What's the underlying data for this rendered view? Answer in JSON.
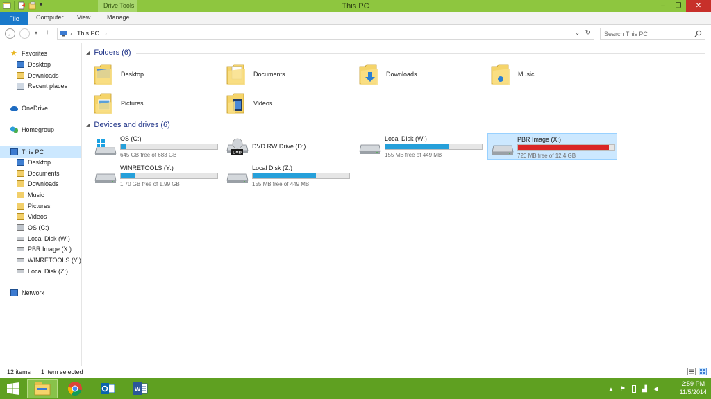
{
  "window": {
    "title": "This PC",
    "context_tab_group": "Drive Tools",
    "controls": {
      "minimize": "–",
      "maximize": "❐",
      "close": "✕"
    }
  },
  "ribbon": {
    "tabs": [
      {
        "label": "File"
      },
      {
        "label": "Computer"
      },
      {
        "label": "View"
      },
      {
        "label": "Manage"
      }
    ]
  },
  "address_bar": {
    "path": "This PC",
    "search_placeholder": "Search This PC",
    "icons": [
      "back-icon",
      "forward-icon",
      "recent-dropdown-icon",
      "up-icon",
      "computer-icon",
      "refresh-icon",
      "search-icon"
    ]
  },
  "nav_pane": {
    "favorites": {
      "label": "Favorites",
      "items": [
        "Desktop",
        "Downloads",
        "Recent places"
      ]
    },
    "onedrive": {
      "label": "OneDrive"
    },
    "homegroup": {
      "label": "Homegroup"
    },
    "this_pc": {
      "label": "This PC",
      "items": [
        "Desktop",
        "Documents",
        "Downloads",
        "Music",
        "Pictures",
        "Videos",
        "OS (C:)",
        "Local Disk (W:)",
        "PBR Image (X:)",
        "WINRETOOLS (Y:)",
        "Local Disk (Z:)"
      ]
    },
    "network": {
      "label": "Network"
    }
  },
  "folders": {
    "header": "Folders (6)",
    "items": [
      "Desktop",
      "Documents",
      "Downloads",
      "Music",
      "Pictures",
      "Videos"
    ]
  },
  "drives": {
    "header": "Devices and drives (6)",
    "items": [
      {
        "name": "OS (C:)",
        "free": "645 GB free of 683 GB",
        "used_fraction": 0.056,
        "icon": "windows-drive-icon"
      },
      {
        "name": "DVD RW Drive (D:)",
        "free": "",
        "used_fraction": null,
        "icon": "dvd-drive-icon"
      },
      {
        "name": "Local Disk (W:)",
        "free": "155 MB free of 449 MB",
        "used_fraction": 0.655,
        "icon": "hard-drive-icon"
      },
      {
        "name": "PBR Image (X:)",
        "free": "720 MB free of 12.4 GB",
        "used_fraction": 0.943,
        "icon": "hard-drive-icon",
        "selected": true
      },
      {
        "name": "WINRETOOLS (Y:)",
        "free": "1.70 GB free of 1.99 GB",
        "used_fraction": 0.146,
        "icon": "hard-drive-icon"
      },
      {
        "name": "Local Disk (Z:)",
        "free": "155 MB free of 449 MB",
        "used_fraction": 0.655,
        "icon": "hard-drive-icon"
      }
    ]
  },
  "status": {
    "items_count": "12 items",
    "selected_count": "1 item selected"
  },
  "taskbar": {
    "apps": [
      "file-explorer-icon",
      "chrome-icon",
      "outlook-icon",
      "word-icon"
    ],
    "clock_time": "2:59 PM",
    "clock_date": "11/5/2014"
  },
  "colors": {
    "title_bar": "#8ec63f",
    "taskbar": "#5fa021",
    "accent": "#1979ca",
    "drive_bar": "#26a0da",
    "drive_bar_full": "#da2626",
    "selection": "#cce8ff"
  }
}
